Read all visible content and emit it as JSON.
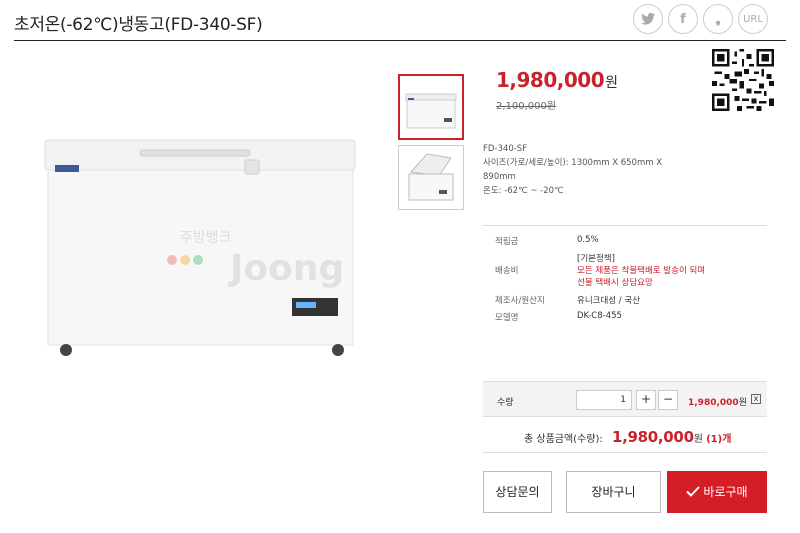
{
  "product": {
    "title": "초저온(-62℃)냉동고(FD-340-SF)",
    "price": "1,980,000",
    "price_unit": "원",
    "old_price": "2,100,000원",
    "desc": [
      "FD-340-SF",
      "사이즈(가로/세로/높이): 1300mm X 650mm X",
      "890mm",
      "온도: -62℃ ~ -20℃"
    ]
  },
  "share": {
    "twitter": "t",
    "facebook": "f",
    "kakao": "❟",
    "url": "URL"
  },
  "info": [
    {
      "label": "적립금",
      "value": "0.5%"
    },
    {
      "label": "배송비",
      "value": "[기본정책]",
      "note1": "모든 제품은 착불택배로 발송이 되며",
      "note2": "선불 택배시 상담요망"
    },
    {
      "label": "제조사/원산지",
      "value": "유니크대성 / 국산"
    },
    {
      "label": "모델명",
      "value": "DK-C8-455"
    }
  ],
  "quantity": {
    "label": "수량",
    "value": "1",
    "plus": "+",
    "minus": "−",
    "line_price": "1,980,000",
    "unit": "원",
    "remove": "x"
  },
  "total": {
    "label": "총 상품금액(수량):",
    "amount": "1,980,000",
    "unit": "원",
    "count": "(1)개"
  },
  "buttons": {
    "inquiry": "상담문의",
    "cart": "장바구니",
    "buy": "바로구매"
  },
  "watermark": {
    "text": "주방뱅크",
    "brand": "Joong"
  },
  "colors": {
    "accent": "#c8232c",
    "buy_button": "#d51d26"
  }
}
